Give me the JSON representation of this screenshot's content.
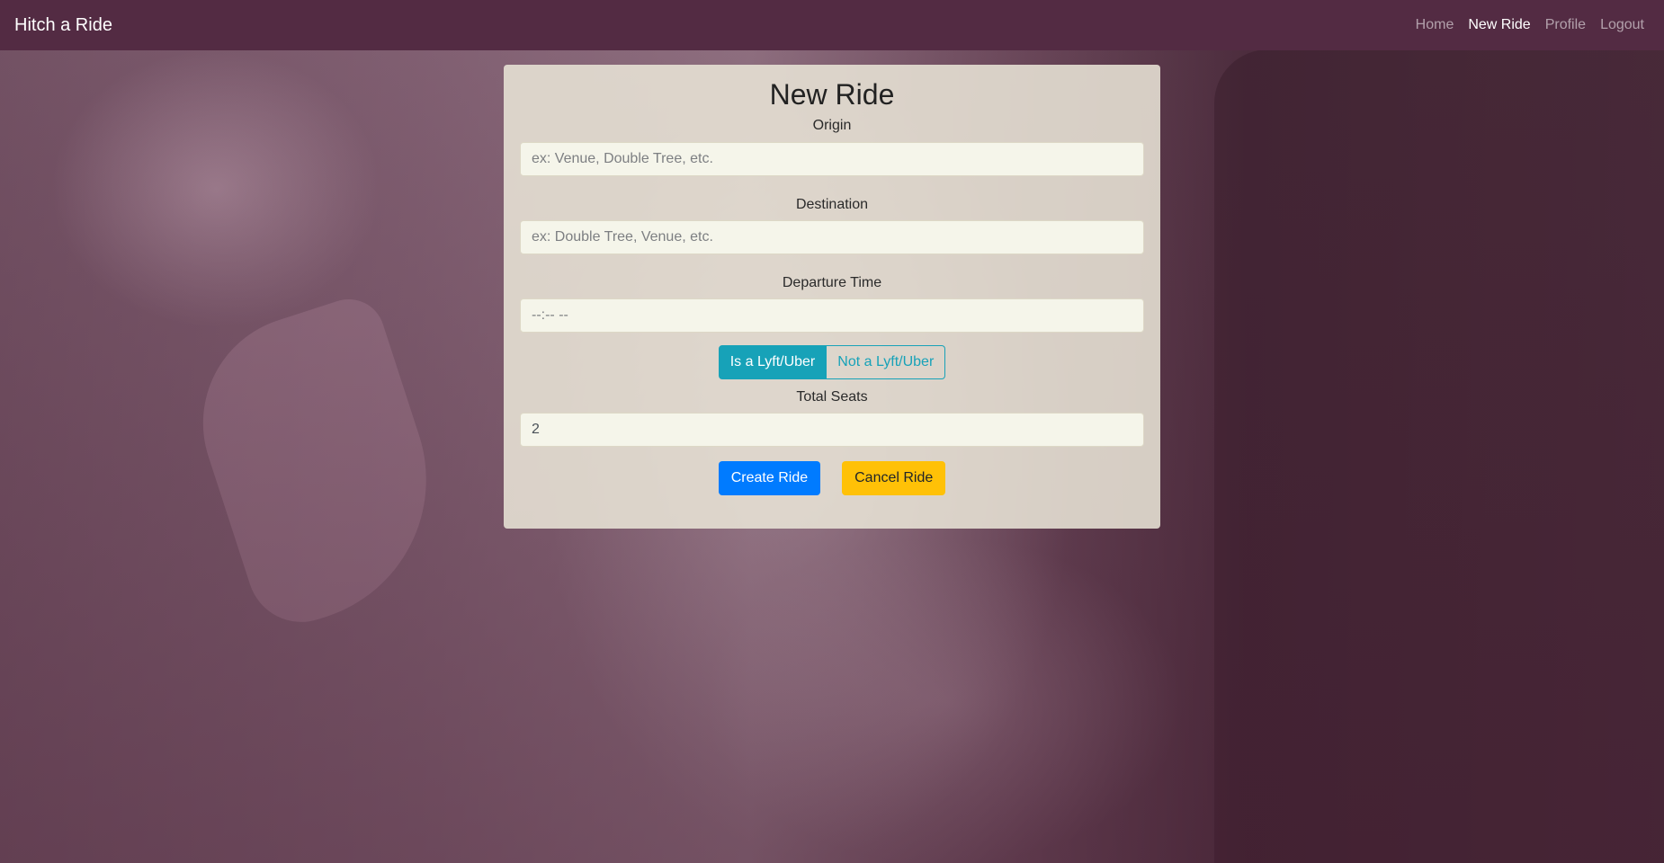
{
  "navbar": {
    "brand": "Hitch a Ride",
    "links": [
      {
        "label": "Home",
        "active": false
      },
      {
        "label": "New Ride",
        "active": true
      },
      {
        "label": "Profile",
        "active": false
      },
      {
        "label": "Logout",
        "active": false
      }
    ]
  },
  "form": {
    "title": "New Ride",
    "origin": {
      "label": "Origin",
      "placeholder": "ex: Venue, Double Tree, etc.",
      "value": ""
    },
    "destination": {
      "label": "Destination",
      "placeholder": "ex: Double Tree, Venue, etc.",
      "value": ""
    },
    "departure": {
      "label": "Departure Time",
      "placeholder": "--:-- --",
      "value": ""
    },
    "ride_type": {
      "options": [
        "Is a Lyft/Uber",
        "Not a Lyft/Uber"
      ],
      "selected": "Is a Lyft/Uber"
    },
    "seats": {
      "label": "Total Seats",
      "value": "2"
    },
    "create_label": "Create Ride",
    "cancel_label": "Cancel Ride"
  },
  "colors": {
    "navbar": "#532b43",
    "toggle_accent": "#17a2b8",
    "primary": "#007bff",
    "warning": "#ffc107"
  }
}
